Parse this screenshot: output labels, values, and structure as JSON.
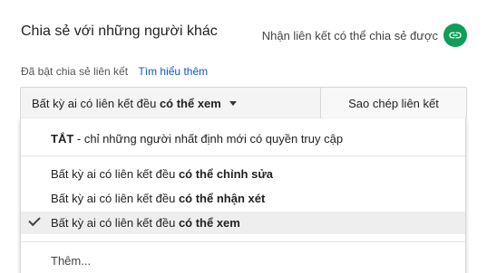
{
  "dialog": {
    "title": "Chia sẻ với những người khác",
    "get_link_label": "Nhận liên kết có thể chia sẻ được",
    "get_link_icon": "link-icon",
    "accent_color": "#0f9d58"
  },
  "link_status": {
    "text": "Đã bật chia sẻ liên kết",
    "learn_more": "Tìm hiểu thêm"
  },
  "access": {
    "current_prefix": "Bất kỳ ai có liên kết đều",
    "current_bold": "có thể xem",
    "copy_button": "Sao chép liên kết"
  },
  "menu": {
    "off_option": {
      "bold": "TẮT",
      "text": " - chỉ những người nhất định mới có quyền truy cập"
    },
    "options": [
      {
        "prefix": "Bất kỳ ai có liên kết đều",
        "bold": "có thể chỉnh sửa",
        "selected": false
      },
      {
        "prefix": "Bất kỳ ai có liên kết đều",
        "bold": "có thể nhận xét",
        "selected": false
      },
      {
        "prefix": "Bất kỳ ai có liên kết đều",
        "bold": "có thể xem",
        "selected": true
      }
    ],
    "more": "Thêm..."
  }
}
